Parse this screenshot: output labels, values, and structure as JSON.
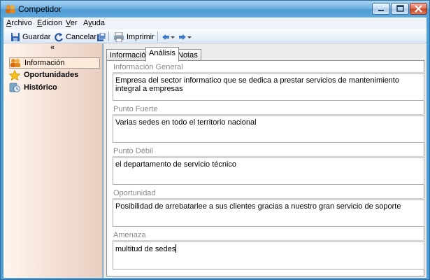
{
  "window": {
    "title": "Competidor"
  },
  "menu": [
    {
      "label": "Archivo",
      "mnemonic": "A"
    },
    {
      "label": "Edicion",
      "mnemonic": "E"
    },
    {
      "label": "Ver",
      "mnemonic": "V"
    },
    {
      "label": "Ayuda",
      "mnemonic": "y"
    }
  ],
  "toolbar": {
    "save_label": "Guardar",
    "cancel_label": "Cancelar",
    "print_label": "Imprimir"
  },
  "sidebar": {
    "collapse_glyph": "«",
    "items": [
      {
        "label": "Información",
        "icon": "contacts-icon",
        "selected": true
      },
      {
        "label": "Oportunidades",
        "icon": "star-icon",
        "selected": false
      },
      {
        "label": "Histórico",
        "icon": "history-icon",
        "selected": false
      }
    ]
  },
  "tabs": [
    {
      "label": "Información",
      "active": false
    },
    {
      "label": "Análisis",
      "active": true
    },
    {
      "label": "Notas",
      "active": false
    }
  ],
  "groups": [
    {
      "label": "Información General",
      "value": "Empresa del sector informatico que se dedica a prestar servicios de mantenimiento integral a empresas"
    },
    {
      "label": "Punto Fuerte",
      "value": "Varias sedes en todo el territorio nacional"
    },
    {
      "label": "Punto Débil",
      "value": "el departamento de servicio técnico"
    },
    {
      "label": "Oportunidad",
      "value": "Posibilidad de arrebatarlee a sus clientes gracias a nuestro gran servicio de soporte"
    },
    {
      "label": "Amenaza",
      "value": "multitud de sedes"
    }
  ],
  "colors": {
    "accent_titlebar": "#5ea9de",
    "sidebar_bg": "#f2dcd0",
    "selected_item": "#fbe9d9"
  }
}
